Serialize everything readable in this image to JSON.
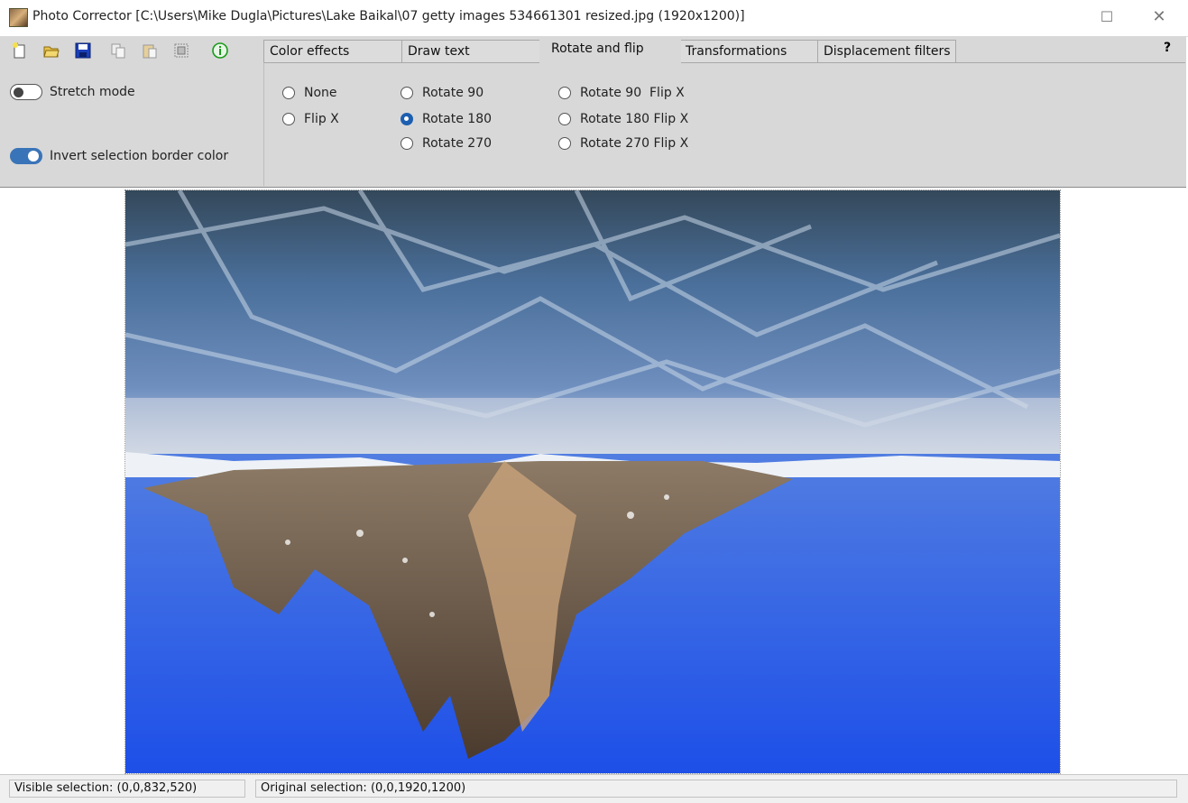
{
  "window": {
    "title": "Photo Corrector [C:\\Users\\Mike Dugla\\Pictures\\Lake Baikal\\07 getty images 534661301 resized.jpg (1920x1200)]",
    "maximize_glyph": "☐",
    "close_glyph": "✕"
  },
  "toolbar": {
    "icons": [
      "new-file-icon",
      "open-folder-icon",
      "save-icon",
      "copy-icon",
      "paste-icon",
      "crop-frame-icon",
      "info-icon"
    ]
  },
  "options": {
    "stretch_mode": {
      "label": "Stretch mode",
      "enabled": false
    },
    "invert_border": {
      "label": "Invert selection border color",
      "enabled": true
    }
  },
  "tabs": [
    {
      "label": "Color effects"
    },
    {
      "label": "Draw text"
    },
    {
      "label": "Rotate and flip"
    },
    {
      "label": "Transformations"
    },
    {
      "label": "Displacement filters"
    }
  ],
  "active_tab": "Rotate and flip",
  "help_label": "?",
  "rotate_options": [
    {
      "label": "None",
      "checked": false
    },
    {
      "label": "Flip X",
      "checked": false
    },
    {
      "label": "Rotate 90",
      "checked": false
    },
    {
      "label": "Rotate 180",
      "checked": true
    },
    {
      "label": "Rotate 270",
      "checked": false
    },
    {
      "label": "Rotate 90  Flip X",
      "checked": false
    },
    {
      "label": "Rotate 180 Flip X",
      "checked": false
    },
    {
      "label": "Rotate 270 Flip X",
      "checked": false
    }
  ],
  "status": {
    "visible_selection": "Visible selection: (0,0,832,520)",
    "original_selection": "Original selection: (0,0,1920,1200)"
  },
  "colors": {
    "accent": "#1d5fb0",
    "toggle_on": "#3a74b8",
    "panel_bg": "#d8d8d8"
  }
}
